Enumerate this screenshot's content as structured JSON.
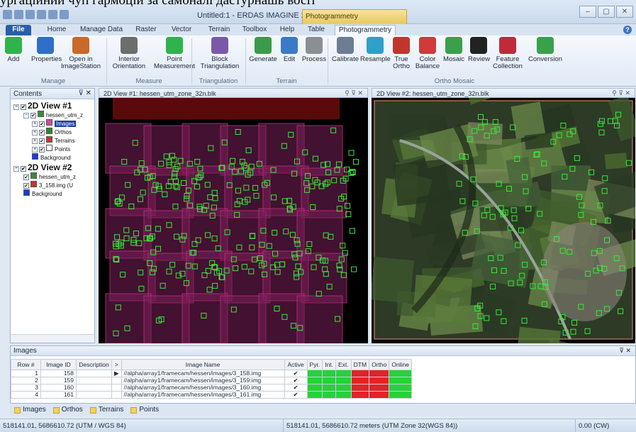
{
  "caption": "ургаційний чуп гармоцій за самоналі дастурнашь восіт",
  "window": {
    "title": "Untitled:1 - ERDAS IMAGINE 2012",
    "context_tab": "Photogrammetry",
    "controls": [
      "‒",
      "▢",
      "✕"
    ]
  },
  "ribbon_tabs": [
    "File",
    "Home",
    "Manage Data",
    "Raster",
    "Vector",
    "Terrain",
    "Toolbox",
    "Help",
    "Table",
    "Photogrammetry"
  ],
  "ribbon": {
    "buttons": [
      {
        "label": "Add",
        "icon": "add-icon",
        "color": "#2fb34a"
      },
      {
        "label": "Properties",
        "icon": "info-icon",
        "color": "#2f6fc7"
      },
      {
        "label": "Open in\nImageStation",
        "icon": "imagestation-icon",
        "color": "#c86a2a"
      },
      {
        "label": "Interior\nOrientation",
        "icon": "interior-orientation-icon",
        "color": "#6d6d6d"
      },
      {
        "label": "Point\nMeasurement",
        "icon": "point-measurement-icon",
        "color": "#2fb34a"
      },
      {
        "label": "Block\nTriangulation",
        "icon": "triangulation-icon",
        "color": "#7a5aa8"
      },
      {
        "label": "Generate",
        "icon": "generate-icon",
        "color": "#3c9a4a"
      },
      {
        "label": "Edit",
        "icon": "edit-icon",
        "color": "#3a7ac6"
      },
      {
        "label": "Process",
        "icon": "process-gear-icon",
        "color": "#8a8f96"
      },
      {
        "label": "Calibrate",
        "icon": "calibrate-icon",
        "color": "#6d7d92"
      },
      {
        "label": "Resample",
        "icon": "resample-icon",
        "color": "#2fa0c8"
      },
      {
        "label": "True\nOrtho",
        "icon": "true-ortho-icon",
        "color": "#c0362c"
      },
      {
        "label": "Color\nBalance",
        "icon": "color-balance-icon",
        "color": "#d03a3a"
      },
      {
        "label": "Mosaic",
        "icon": "mosaic-icon",
        "color": "#3aa04a"
      },
      {
        "label": "Review",
        "icon": "review-icon",
        "color": "#222222"
      },
      {
        "label": "Feature\nCollection",
        "icon": "feature-collection-icon",
        "color": "#c02a3a"
      },
      {
        "label": "Conversion",
        "icon": "conversion-icon",
        "color": "#3aa04a"
      }
    ],
    "groups": [
      "Manage",
      "Measure",
      "Triangulation",
      "Terrain",
      "Ortho Mosaic"
    ]
  },
  "contents": {
    "title": "Contents",
    "controls": "⊽ ✕",
    "tree": [
      {
        "label": "2D View #1",
        "big": true
      },
      {
        "label": "hessen_utm_z"
      },
      {
        "label": "Images",
        "selected": true
      },
      {
        "label": "Orthos"
      },
      {
        "label": "Terrains"
      },
      {
        "label": "Points"
      },
      {
        "label": "Background"
      },
      {
        "label": "2D View #2",
        "big": true
      },
      {
        "label": "hessen_utm_z"
      },
      {
        "label": "3_158.img (U"
      },
      {
        "label": "Background"
      }
    ]
  },
  "view1": {
    "title": "2D View #1: hessen_utm_zone_32n.blk"
  },
  "view2": {
    "title": "2D View #2: hessen_utm_zone_32n.blk"
  },
  "images_panel": {
    "title": "Images",
    "controls": "⊽ ✕",
    "columns": [
      "Row #",
      "Image ID",
      "Description",
      ">",
      "Image Name",
      "Active",
      "Pyr.",
      "Int.",
      "Ext.",
      "DTM",
      "Ortho",
      "Online"
    ],
    "rows": [
      {
        "row": "1",
        "id": "158",
        "desc": "",
        "ptr": "▶",
        "name": "//alpha/array1/framecam/hessen/images/3_158.img",
        "active": "✔",
        "status": [
          "green",
          "green",
          "green",
          "red",
          "red",
          "green"
        ]
      },
      {
        "row": "2",
        "id": "159",
        "desc": "",
        "ptr": "",
        "name": "//alpha/array1/framecam/hessen/images/3_159.img",
        "active": "✔",
        "status": [
          "green",
          "green",
          "green",
          "red",
          "red",
          "green"
        ]
      },
      {
        "row": "3",
        "id": "160",
        "desc": "",
        "ptr": "",
        "name": "//alpha/array1/framecam/hessen/images/3_160.img",
        "active": "✔",
        "status": [
          "green",
          "green",
          "green",
          "red",
          "red",
          "green"
        ]
      },
      {
        "row": "4",
        "id": "161",
        "desc": "",
        "ptr": "",
        "name": "//alpha/array1/framecam/hessen/images/3_161.img",
        "active": "✔",
        "status": [
          "green",
          "green",
          "green",
          "red",
          "red",
          "green"
        ]
      }
    ]
  },
  "bottom_tabs": [
    "Images",
    "Orthos",
    "Terrains",
    "Points"
  ],
  "status": {
    "left": "518141.01, 5686610.72  (UTM / WGS 84)",
    "middle": "518141.01, 5686610.72 meters (UTM Zone 32(WGS 84))",
    "right": "0.00 (CW)"
  },
  "colors": {
    "accent": "#2a5ea8",
    "tie_point": "#39e83a",
    "frame_fill": "#7a1f5a",
    "status_green": "#25d23a",
    "status_red": "#e3222a"
  }
}
